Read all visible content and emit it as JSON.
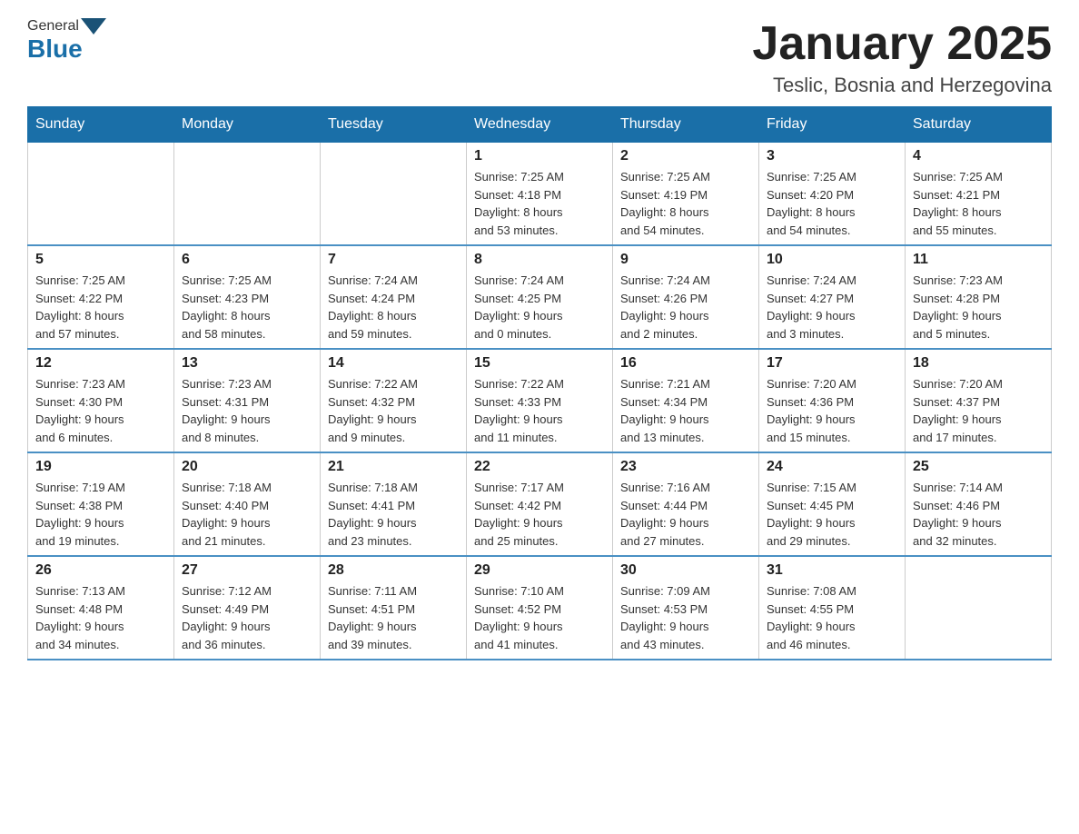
{
  "header": {
    "title": "January 2025",
    "subtitle": "Teslic, Bosnia and Herzegovina",
    "logo_general": "General",
    "logo_blue": "Blue"
  },
  "weekdays": [
    "Sunday",
    "Monday",
    "Tuesday",
    "Wednesday",
    "Thursday",
    "Friday",
    "Saturday"
  ],
  "weeks": [
    [
      {
        "day": "",
        "info": ""
      },
      {
        "day": "",
        "info": ""
      },
      {
        "day": "",
        "info": ""
      },
      {
        "day": "1",
        "info": "Sunrise: 7:25 AM\nSunset: 4:18 PM\nDaylight: 8 hours\nand 53 minutes."
      },
      {
        "day": "2",
        "info": "Sunrise: 7:25 AM\nSunset: 4:19 PM\nDaylight: 8 hours\nand 54 minutes."
      },
      {
        "day": "3",
        "info": "Sunrise: 7:25 AM\nSunset: 4:20 PM\nDaylight: 8 hours\nand 54 minutes."
      },
      {
        "day": "4",
        "info": "Sunrise: 7:25 AM\nSunset: 4:21 PM\nDaylight: 8 hours\nand 55 minutes."
      }
    ],
    [
      {
        "day": "5",
        "info": "Sunrise: 7:25 AM\nSunset: 4:22 PM\nDaylight: 8 hours\nand 57 minutes."
      },
      {
        "day": "6",
        "info": "Sunrise: 7:25 AM\nSunset: 4:23 PM\nDaylight: 8 hours\nand 58 minutes."
      },
      {
        "day": "7",
        "info": "Sunrise: 7:24 AM\nSunset: 4:24 PM\nDaylight: 8 hours\nand 59 minutes."
      },
      {
        "day": "8",
        "info": "Sunrise: 7:24 AM\nSunset: 4:25 PM\nDaylight: 9 hours\nand 0 minutes."
      },
      {
        "day": "9",
        "info": "Sunrise: 7:24 AM\nSunset: 4:26 PM\nDaylight: 9 hours\nand 2 minutes."
      },
      {
        "day": "10",
        "info": "Sunrise: 7:24 AM\nSunset: 4:27 PM\nDaylight: 9 hours\nand 3 minutes."
      },
      {
        "day": "11",
        "info": "Sunrise: 7:23 AM\nSunset: 4:28 PM\nDaylight: 9 hours\nand 5 minutes."
      }
    ],
    [
      {
        "day": "12",
        "info": "Sunrise: 7:23 AM\nSunset: 4:30 PM\nDaylight: 9 hours\nand 6 minutes."
      },
      {
        "day": "13",
        "info": "Sunrise: 7:23 AM\nSunset: 4:31 PM\nDaylight: 9 hours\nand 8 minutes."
      },
      {
        "day": "14",
        "info": "Sunrise: 7:22 AM\nSunset: 4:32 PM\nDaylight: 9 hours\nand 9 minutes."
      },
      {
        "day": "15",
        "info": "Sunrise: 7:22 AM\nSunset: 4:33 PM\nDaylight: 9 hours\nand 11 minutes."
      },
      {
        "day": "16",
        "info": "Sunrise: 7:21 AM\nSunset: 4:34 PM\nDaylight: 9 hours\nand 13 minutes."
      },
      {
        "day": "17",
        "info": "Sunrise: 7:20 AM\nSunset: 4:36 PM\nDaylight: 9 hours\nand 15 minutes."
      },
      {
        "day": "18",
        "info": "Sunrise: 7:20 AM\nSunset: 4:37 PM\nDaylight: 9 hours\nand 17 minutes."
      }
    ],
    [
      {
        "day": "19",
        "info": "Sunrise: 7:19 AM\nSunset: 4:38 PM\nDaylight: 9 hours\nand 19 minutes."
      },
      {
        "day": "20",
        "info": "Sunrise: 7:18 AM\nSunset: 4:40 PM\nDaylight: 9 hours\nand 21 minutes."
      },
      {
        "day": "21",
        "info": "Sunrise: 7:18 AM\nSunset: 4:41 PM\nDaylight: 9 hours\nand 23 minutes."
      },
      {
        "day": "22",
        "info": "Sunrise: 7:17 AM\nSunset: 4:42 PM\nDaylight: 9 hours\nand 25 minutes."
      },
      {
        "day": "23",
        "info": "Sunrise: 7:16 AM\nSunset: 4:44 PM\nDaylight: 9 hours\nand 27 minutes."
      },
      {
        "day": "24",
        "info": "Sunrise: 7:15 AM\nSunset: 4:45 PM\nDaylight: 9 hours\nand 29 minutes."
      },
      {
        "day": "25",
        "info": "Sunrise: 7:14 AM\nSunset: 4:46 PM\nDaylight: 9 hours\nand 32 minutes."
      }
    ],
    [
      {
        "day": "26",
        "info": "Sunrise: 7:13 AM\nSunset: 4:48 PM\nDaylight: 9 hours\nand 34 minutes."
      },
      {
        "day": "27",
        "info": "Sunrise: 7:12 AM\nSunset: 4:49 PM\nDaylight: 9 hours\nand 36 minutes."
      },
      {
        "day": "28",
        "info": "Sunrise: 7:11 AM\nSunset: 4:51 PM\nDaylight: 9 hours\nand 39 minutes."
      },
      {
        "day": "29",
        "info": "Sunrise: 7:10 AM\nSunset: 4:52 PM\nDaylight: 9 hours\nand 41 minutes."
      },
      {
        "day": "30",
        "info": "Sunrise: 7:09 AM\nSunset: 4:53 PM\nDaylight: 9 hours\nand 43 minutes."
      },
      {
        "day": "31",
        "info": "Sunrise: 7:08 AM\nSunset: 4:55 PM\nDaylight: 9 hours\nand 46 minutes."
      },
      {
        "day": "",
        "info": ""
      }
    ]
  ]
}
